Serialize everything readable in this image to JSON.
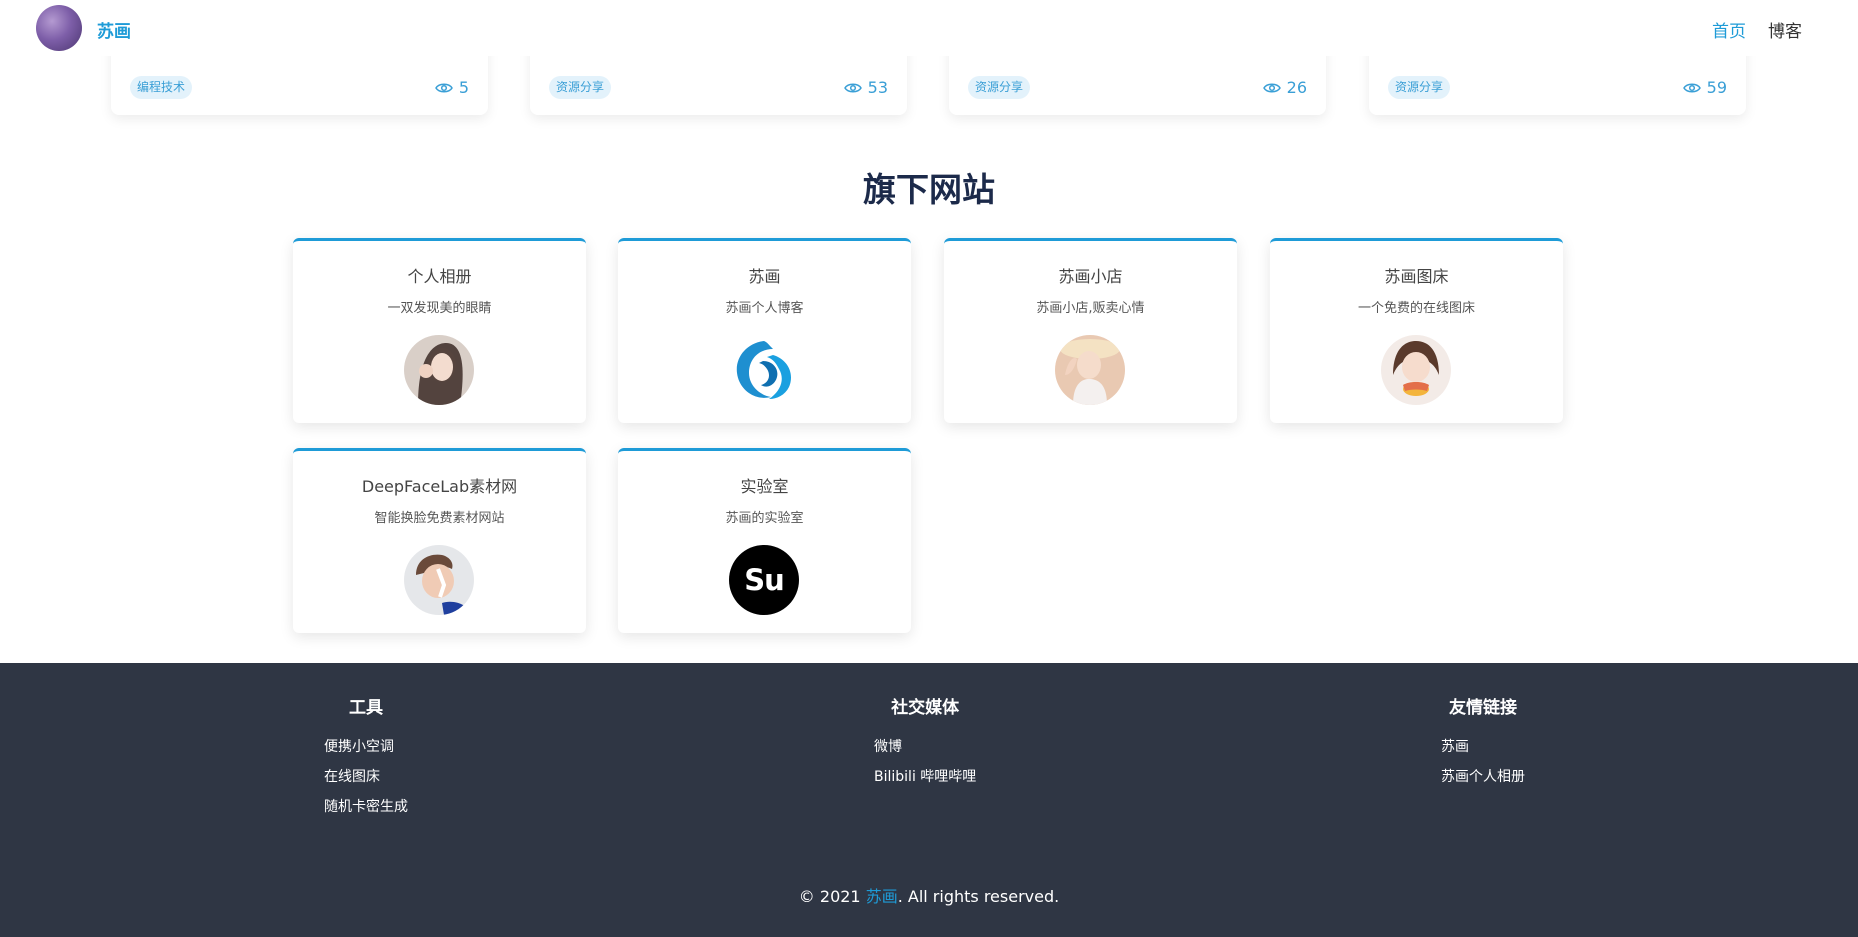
{
  "header": {
    "brand": "苏画",
    "nav": [
      {
        "label": "首页",
        "active": true
      },
      {
        "label": "博客",
        "active": false
      }
    ]
  },
  "top_cards": [
    {
      "tag": "编程技术",
      "views": "5"
    },
    {
      "tag": "资源分享",
      "views": "53"
    },
    {
      "tag": "资源分享",
      "views": "26"
    },
    {
      "tag": "资源分享",
      "views": "59"
    }
  ],
  "sites_section": {
    "title": "旗下网站",
    "sites": [
      {
        "name": "个人相册",
        "desc": "一双发现美的眼睛",
        "logo": "portrait-girl-icon"
      },
      {
        "name": "苏画",
        "desc": "苏画个人博客",
        "logo": "swirl-logo-icon"
      },
      {
        "name": "苏画小店",
        "desc": "苏画小店,贩卖心情",
        "logo": "portrait-girl-hat-icon"
      },
      {
        "name": "苏画图床",
        "desc": "一个免费的在线图床",
        "logo": "portrait-girl-smile-icon"
      },
      {
        "name": "DeepFaceLab素材网",
        "desc": "智能换脸免费素材网站",
        "logo": "portrait-man-icon"
      },
      {
        "name": "实验室",
        "desc": "苏画的实验室",
        "logo": "su-logo-icon",
        "logo_text": "Su"
      }
    ]
  },
  "footer": {
    "columns": [
      {
        "title": "工具",
        "links": [
          "便携小空调",
          "在线图床",
          "随机卡密生成"
        ]
      },
      {
        "title": "社交媒体",
        "links": [
          "微博",
          "Bilibili 哔哩哔哩"
        ]
      },
      {
        "title": "友情链接",
        "links": [
          "苏画",
          "苏画个人相册"
        ]
      }
    ],
    "copyright_prefix": "© 2021 ",
    "copyright_brand": "苏画",
    "copyright_suffix": ". All rights reserved."
  },
  "colors": {
    "accent": "#1e9bd7",
    "footer_bg": "#2f3644",
    "title": "#1c2a4a"
  }
}
